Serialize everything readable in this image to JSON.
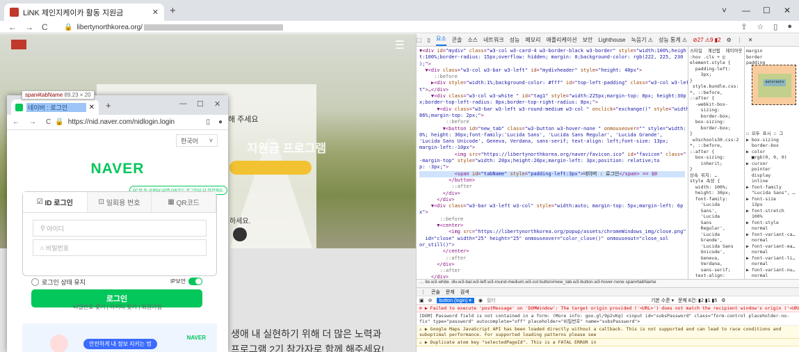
{
  "browser": {
    "tab_title": "LiNK 제인지케이카 활동 지원금",
    "url": "libertynorthkorea.org/",
    "window_controls": [
      "˅",
      "—",
      "☐",
      "✕"
    ]
  },
  "site": {
    "card_text": "해 주세요",
    "big_text": "지원금 프로그램",
    "small_text": "하세요.",
    "body_lines": [
      "생애 내 실현하기 위해 더 많은 노력과",
      "프로그램 2기 참가자로 함께 해주세요!"
    ]
  },
  "tooltip": {
    "name": "span#tabName",
    "dims": "89.23 × 20"
  },
  "popup": {
    "tab_title": "네이버 : 로그인",
    "url": "https://nid.naver.com/nidlogin.login",
    "lang": "한국어",
    "logo": "NAVER",
    "green_pill": "PC방 등 공용PC라면 QR코드 로그인이 더 안전해요.",
    "tabs": [
      "ID 로그인",
      "일회용 번호",
      "QR코드"
    ],
    "id_placeholder": "아이디",
    "pw_placeholder": "비밀번호",
    "keep": "로그인 상태 유지",
    "ip": "IP보안",
    "login": "로그인",
    "links": "비밀번호 찾기  |  아이디 찾기  |  회원가입",
    "banner_pill": "안전하게 내 정보 지키는 법",
    "banner_logo": "NAVER"
  },
  "devtools": {
    "tabs": [
      "요소",
      "콘솔",
      "소스",
      "네트워크",
      "성능",
      "메모리",
      "애플리케이션",
      "보안",
      "Lighthouse",
      "녹음기 ⚠",
      "성능 통계 ⚠"
    ],
    "counts": "⊘27 ⚠9 ▮2",
    "style_tabs": "스타일  계산됨  레이아웃  »",
    "breadcrumb": "… ite.w3-white.  div.w3-bar.w3-left.w3-round-medium.w3-col  button#new_tab.w3-button.w3-hover-none  span#tabName",
    "console_tabs": [
      "콘솔",
      "문제",
      "검색"
    ],
    "context": "button (login) ▾",
    "filter": "필터",
    "level": "기본 수준 ▾",
    "issues": "문제 8건: ▮2 ▮1 ▮5",
    "messages": [
      "⊘ ▶ Failed to execute 'postMessage' on 'DOMWindow': The target origin provided ('<URL>') does not match the recipient window's origin ('<URL>').",
      "[DOM] Password field is not contained in a form: (More info: goo.gl/9p2vKq)   <input id=\"subsPassword\" class=\"form-control placeholder-no-fix\" type=\"password\" autocomplete=\"off\" placeholder=\"비밀번호\" name=\"subsPassword\">",
      "⚠ ▶ Google Maps JavaScript API has been loaded directly without a callback. This is not supported and can lead to race conditions and suboptimal performance. For supported loading patterns please see",
      "⚠ ▶ Duplicate atom key \"selectedPageId\". This is a FATAL ERROR in"
    ]
  }
}
